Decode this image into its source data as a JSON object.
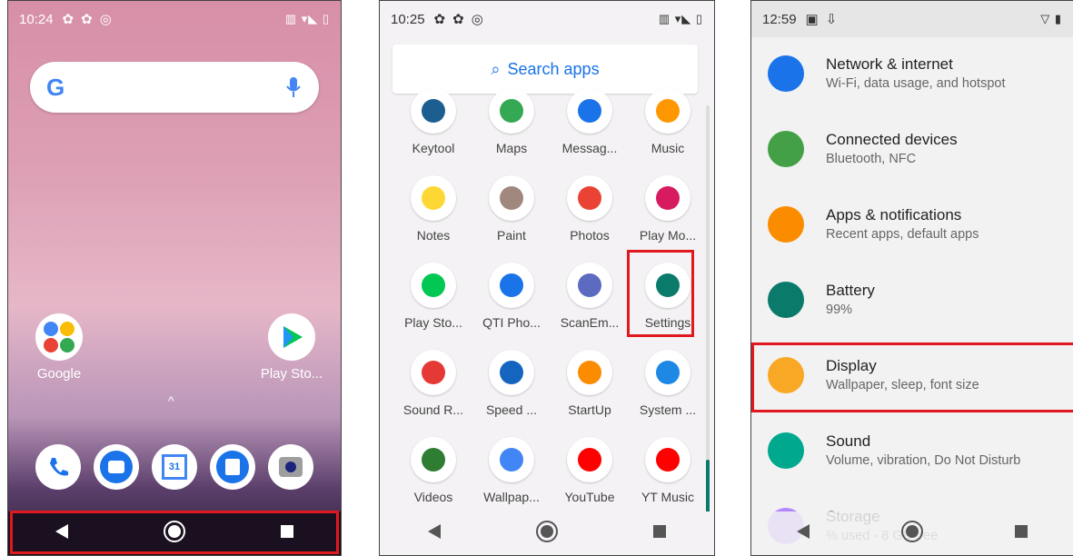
{
  "home": {
    "time": "10:24",
    "apps": [
      {
        "label": "Google",
        "icon": "google-folder-icon"
      },
      {
        "label": "Play Sto...",
        "icon": "play-store-icon"
      }
    ],
    "dock": [
      {
        "name": "phone-icon"
      },
      {
        "name": "messages-icon"
      },
      {
        "name": "calendar-icon",
        "text": "31"
      },
      {
        "name": "contacts-icon"
      },
      {
        "name": "camera-icon"
      }
    ]
  },
  "drawer": {
    "time": "10:25",
    "search_placeholder": "Search apps",
    "apps": [
      {
        "label": "Keytool",
        "color": "#1c5e8f"
      },
      {
        "label": "Maps",
        "color": "#34a853"
      },
      {
        "label": "Messag...",
        "color": "#1a73e8"
      },
      {
        "label": "Music",
        "color": "#ff9800"
      },
      {
        "label": "Notes",
        "color": "#fdd835"
      },
      {
        "label": "Paint",
        "color": "#a1887f"
      },
      {
        "label": "Photos",
        "color": "#ea4335"
      },
      {
        "label": "Play Mo...",
        "color": "#d81b60"
      },
      {
        "label": "Play Sto...",
        "color": "#00c853"
      },
      {
        "label": "QTI Pho...",
        "color": "#1a73e8"
      },
      {
        "label": "ScanEm...",
        "color": "#5c6bc0"
      },
      {
        "label": "Settings",
        "color": "#0a7a6a"
      },
      {
        "label": "Sound R...",
        "color": "#e53935"
      },
      {
        "label": "Speed ...",
        "color": "#1565c0"
      },
      {
        "label": "StartUp",
        "color": "#fb8c00"
      },
      {
        "label": "System ...",
        "color": "#1e88e5"
      },
      {
        "label": "Videos",
        "color": "#2e7d32"
      },
      {
        "label": "Wallpap...",
        "color": "#4285f4"
      },
      {
        "label": "YouTube",
        "color": "#ff0000"
      },
      {
        "label": "YT Music",
        "color": "#ff0000"
      }
    ]
  },
  "settings": {
    "time": "12:59",
    "items": [
      {
        "title": "Network & internet",
        "sub": "Wi-Fi, data usage, and hotspot",
        "color": "#1a73e8",
        "icon": "wifi-icon"
      },
      {
        "title": "Connected devices",
        "sub": "Bluetooth, NFC",
        "color": "#43a047",
        "icon": "devices-icon"
      },
      {
        "title": "Apps & notifications",
        "sub": "Recent apps, default apps",
        "color": "#fb8c00",
        "icon": "apps-icon"
      },
      {
        "title": "Battery",
        "sub": "99%",
        "color": "#0a7a6a",
        "icon": "battery-icon"
      },
      {
        "title": "Display",
        "sub": "Wallpaper, sleep, font size",
        "color": "#f9a825",
        "icon": "display-icon"
      },
      {
        "title": "Sound",
        "sub": "Volume, vibration, Do Not Disturb",
        "color": "#00a88e",
        "icon": "sound-icon"
      },
      {
        "title": "Storage",
        "sub": "% used - 8 GB free",
        "color": "#b388ff",
        "icon": "storage-icon"
      }
    ]
  }
}
